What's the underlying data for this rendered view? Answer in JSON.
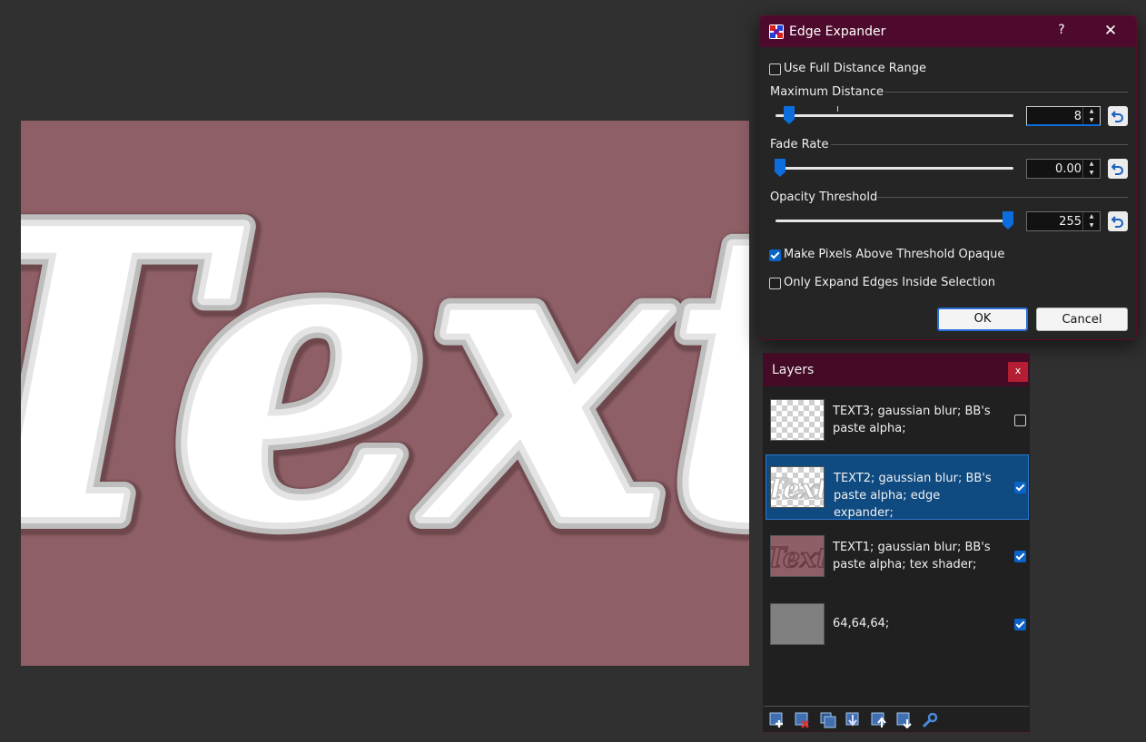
{
  "canvas": {
    "text": "Text",
    "background_color": "#8e5f66"
  },
  "dialog": {
    "title": "Edge Expander",
    "help_label": "?",
    "close_label": "✕",
    "use_full_range": {
      "label": "Use Full Distance Range",
      "checked": false
    },
    "max_distance": {
      "label": "Maximum Distance",
      "value": "8",
      "fraction": 0.09
    },
    "fade_rate": {
      "label": "Fade Rate",
      "value": "0.00",
      "fraction": 0.0
    },
    "opacity_threshold": {
      "label": "Opacity Threshold",
      "value": "255",
      "fraction": 1.0
    },
    "make_opaque": {
      "label": "Make Pixels Above Threshold Opaque",
      "checked": true
    },
    "only_inside": {
      "label": "Only Expand Edges Inside Selection",
      "checked": false
    },
    "ok_label": "OK",
    "cancel_label": "Cancel"
  },
  "layers": {
    "title": "Layers",
    "close_label": "x",
    "items": [
      {
        "name": "TEXT3; gaussian blur; BB's paste alpha;",
        "visible": false,
        "selected": false
      },
      {
        "name": "TEXT2; gaussian blur; BB's paste alpha; edge expander;",
        "visible": true,
        "selected": true
      },
      {
        "name": "TEXT1; gaussian blur; BB's paste alpha; tex shader;",
        "visible": true,
        "selected": false
      },
      {
        "name": "64,64,64;",
        "visible": true,
        "selected": false
      }
    ],
    "toolbar": [
      "add-layer-icon",
      "delete-layer-icon",
      "duplicate-layer-icon",
      "merge-down-icon",
      "move-up-icon",
      "move-down-icon",
      "properties-icon"
    ]
  }
}
